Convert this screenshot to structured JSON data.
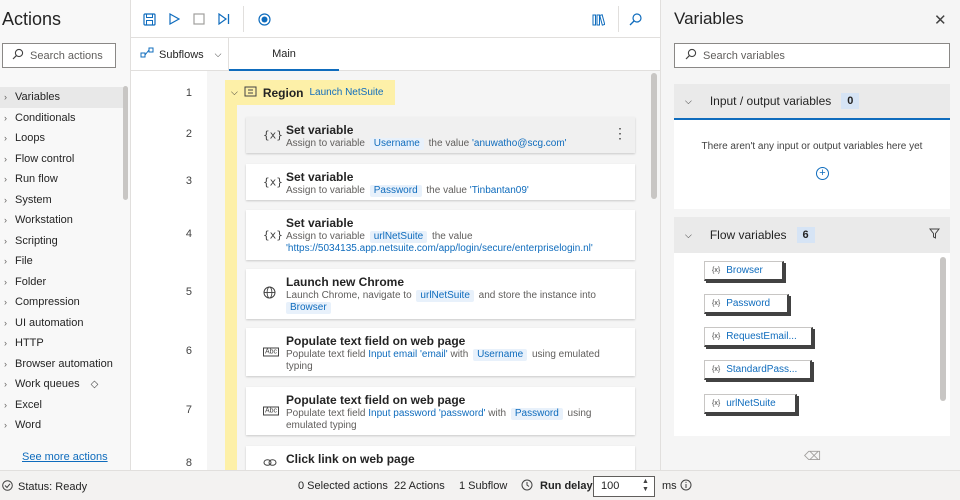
{
  "actions_pane": {
    "title": "Actions",
    "search_placeholder": "Search actions",
    "categories": [
      "Variables",
      "Conditionals",
      "Loops",
      "Flow control",
      "Run flow",
      "System",
      "Workstation",
      "Scripting",
      "File",
      "Folder",
      "Compression",
      "UI automation",
      "HTTP",
      "Browser automation",
      "Work queues",
      "Excel",
      "Word"
    ],
    "see_more": "See more actions"
  },
  "tabs": {
    "subflows": "Subflows",
    "main": "Main"
  },
  "editor": {
    "line_numbers": [
      "1",
      "2",
      "3",
      "4",
      "5",
      "6",
      "7",
      "8"
    ],
    "region": {
      "label": "Region",
      "name": "Launch NetSuite"
    },
    "steps": [
      {
        "icon": "{x}",
        "title": "Set variable",
        "p1": "Assign to variable",
        "v1": "Username",
        "p2": "the value",
        "val": "'anuwatho@scg.com'"
      },
      {
        "icon": "{x}",
        "title": "Set variable",
        "p1": "Assign to variable",
        "v1": "Password",
        "p2": "the value",
        "val": "'Tinbantan09'"
      },
      {
        "icon": "{x}",
        "title": "Set variable",
        "p1": "Assign to variable",
        "v1": "urlNetSuite",
        "p2": "the value",
        "val": "'https://5034135.app.netsuite.com/app/login/secure/enterpriselogin.nl'"
      },
      {
        "icon": "globe",
        "title": "Launch new Chrome",
        "p1": "Launch Chrome, navigate to",
        "v1": "urlNetSuite",
        "p2": "and store the instance into",
        "v2": "Browser"
      },
      {
        "icon": "Abc",
        "title": "Populate text field on web page",
        "p1": "Populate text field",
        "link": "Input email 'email'",
        "p2": "with",
        "v1": "Username",
        "p3": "using emulated typing"
      },
      {
        "icon": "Abc",
        "title": "Populate text field on web page",
        "p1": "Populate text field",
        "link": "Input password 'password'",
        "p2": "with",
        "v1": "Password",
        "p3": "using emulated typing"
      },
      {
        "icon": "link",
        "title": "Click link on web page"
      }
    ]
  },
  "variables_pane": {
    "title": "Variables",
    "search_placeholder": "Search variables",
    "io_section": {
      "title": "Input / output variables",
      "count": "0",
      "empty_message": "There aren't any input or output variables here yet"
    },
    "flow_section": {
      "title": "Flow variables",
      "count": "6",
      "items": [
        "Browser",
        "Password",
        "RequestEmail...",
        "StandardPass...",
        "urlNetSuite"
      ]
    }
  },
  "status_bar": {
    "status": "Status: Ready",
    "selected": "0 Selected actions",
    "actions": "22 Actions",
    "subflow": "1 Subflow",
    "run_delay_label": "Run delay",
    "run_delay_value": "100",
    "unit": "ms"
  },
  "colors": {
    "accent": "#0f6cbd",
    "region": "#fdf0a8"
  }
}
